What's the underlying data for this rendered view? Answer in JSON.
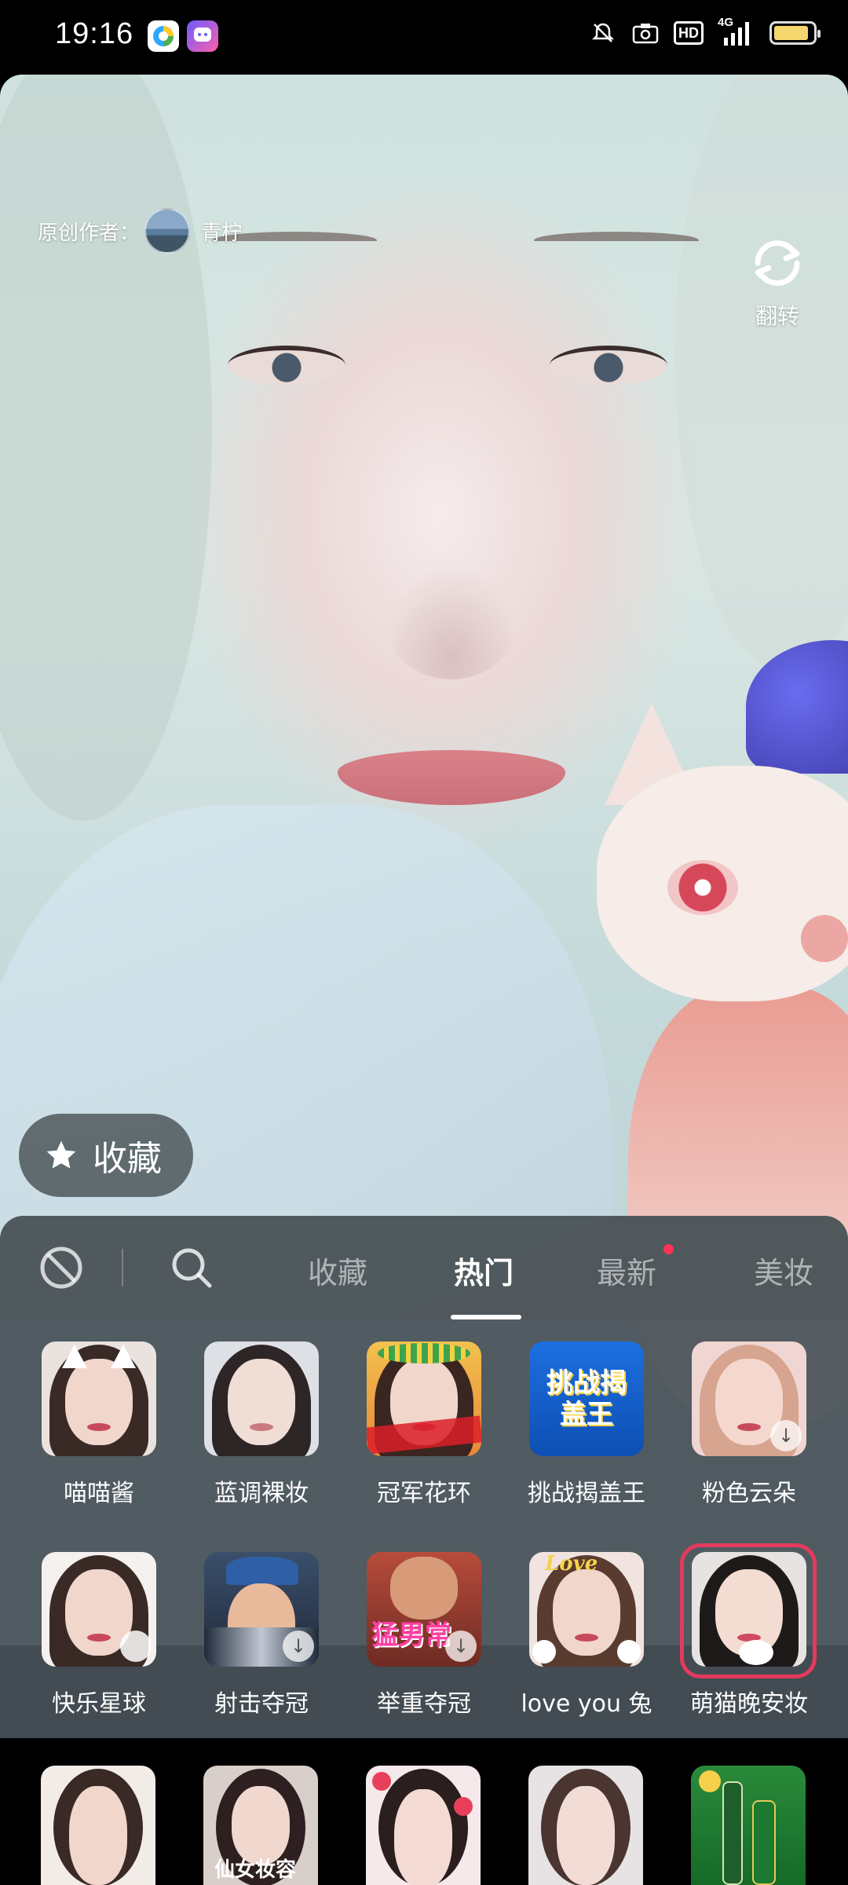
{
  "status_bar": {
    "time": "19:16",
    "icons": [
      "browser-app-icon",
      "chat-app-icon",
      "mute-bell-icon",
      "camera-icon",
      "hd-icon",
      "signal-4g-icon",
      "battery-icon"
    ],
    "hd_label": "HD",
    "network_label": "4G",
    "battery_level": 0.9
  },
  "preview": {
    "author_prefix": "原创作者：",
    "author_name": "青柠",
    "flip_label": "翻转"
  },
  "favorite_button": {
    "label": "收藏",
    "icon": "star-icon"
  },
  "panel": {
    "tabs": [
      {
        "label": "收藏",
        "active": false
      },
      {
        "label": "热门",
        "active": true
      },
      {
        "label": "最新",
        "active": false,
        "badge": "red-dot"
      },
      {
        "label": "美妆",
        "active": false
      }
    ],
    "effects_row1": [
      {
        "label": "喵喵酱"
      },
      {
        "label": "蓝调裸妆"
      },
      {
        "label": "冠军花环"
      },
      {
        "label": "挑战揭盖王",
        "thumb_text": "挑战揭盖王"
      },
      {
        "label": "粉色云朵"
      }
    ],
    "effects_row2": [
      {
        "label": "快乐星球"
      },
      {
        "label": "射击夺冠"
      },
      {
        "label": "举重夺冠",
        "thumb_text": "猛男常"
      },
      {
        "label": "love you 兔",
        "thumb_text": "Love"
      },
      {
        "label": "萌猫晚安妆",
        "selected": true
      }
    ],
    "bottom_row": [
      {
        "thumb_text": ""
      },
      {
        "thumb_text": "仙女妆容"
      },
      {
        "thumb_text": ""
      },
      {
        "thumb_text": ""
      },
      {
        "thumb_text": ""
      }
    ],
    "colors": {
      "accent_selected": "#e33a5d",
      "badge": "#ff3355"
    }
  }
}
